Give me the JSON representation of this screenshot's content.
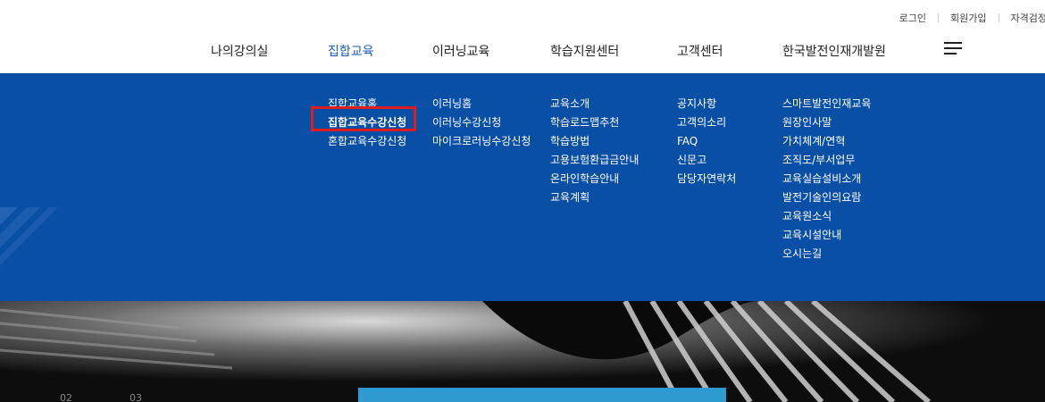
{
  "utility_links": [
    "로그인",
    "회원가입",
    "자격검정"
  ],
  "nav": {
    "items": [
      {
        "label": "나의강의실"
      },
      {
        "label": "집합교육",
        "active": true
      },
      {
        "label": "이러닝교육"
      },
      {
        "label": "학습지원센터"
      },
      {
        "label": "고객센터"
      },
      {
        "label": "한국발전인재개발원"
      }
    ],
    "menu_icon": "hamburger-menu-icon"
  },
  "mega_menu": {
    "columns": [
      {
        "items": [
          "집합교육홈",
          "집합교육수강신청",
          "혼합교육수강신청"
        ],
        "current": "집합교육수강신청"
      },
      {
        "items": [
          "이러닝홈",
          "이러닝수강신청",
          "마이크로러닝수강신청"
        ]
      },
      {
        "items": [
          "교육소개",
          "학습로드맵추천",
          "학습방법",
          "고용보험환급금안내",
          "온라인학습안내",
          "교육계획"
        ]
      },
      {
        "items": [
          "공지사항",
          "고객의소리",
          "FAQ",
          "신문고",
          "담당자연락처"
        ]
      },
      {
        "items": [
          "스마트발전인재교육",
          "원장인사말",
          "가치체계/연혁",
          "조직도/부서업무",
          "교육실습설비소개",
          "발전기술인의요람",
          "교육원소식",
          "교육시설안내",
          "오시는길"
        ]
      }
    ]
  },
  "hero": {
    "slide_numbers": [
      "02",
      "03"
    ]
  },
  "colors": {
    "accent": "#1a5cb8",
    "mega_menu_bg": "#0a4fa6",
    "highlight_border": "#e01b1b",
    "cta": "#2e9bd0"
  }
}
